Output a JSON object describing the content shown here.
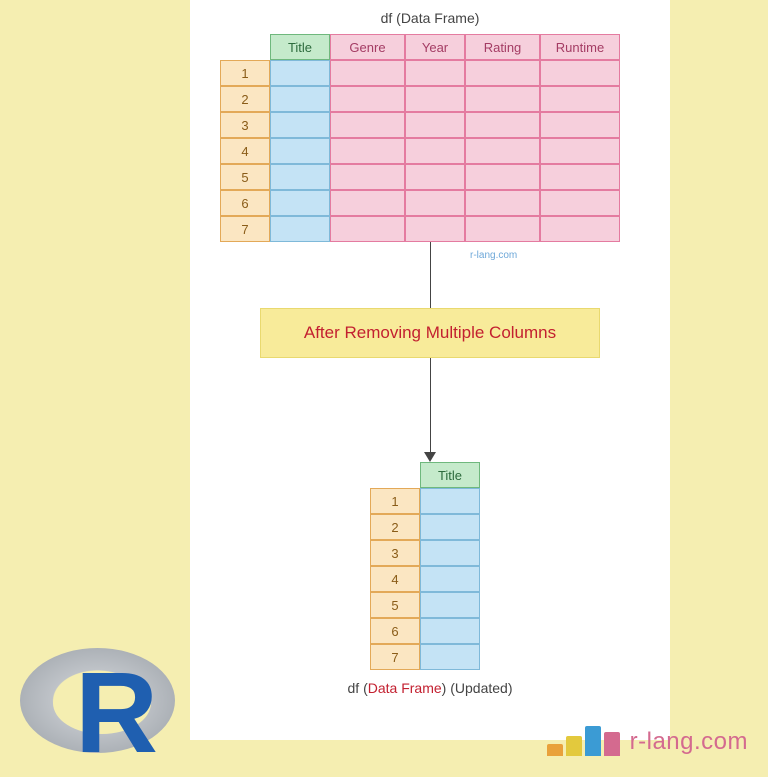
{
  "topTitle": "df (Data Frame)",
  "table1": {
    "headers": [
      "Title",
      "Genre",
      "Year",
      "Rating",
      "Runtime"
    ],
    "rows": [
      "1",
      "2",
      "3",
      "4",
      "5",
      "6",
      "7"
    ]
  },
  "watermark": "r-lang.com",
  "banner": "After Removing Multiple Columns",
  "table2": {
    "headers": [
      "Title"
    ],
    "rows": [
      "1",
      "2",
      "3",
      "4",
      "5",
      "6",
      "7"
    ]
  },
  "bottomTitle": {
    "pre": "df (",
    "mid": "Data Frame",
    "post": ") (Updated)"
  },
  "brandText": "r-lang.com"
}
